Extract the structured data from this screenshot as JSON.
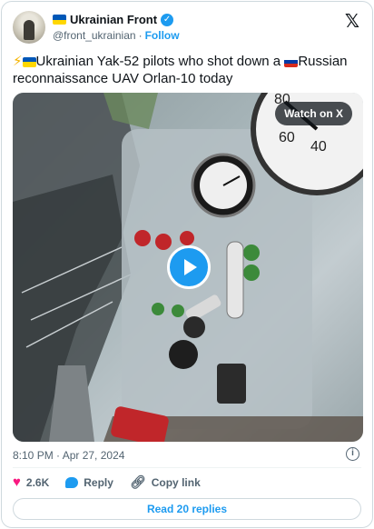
{
  "author": {
    "display_name": "Ukrainian Front",
    "handle": "@front_ukrainian",
    "follow_label": "Follow"
  },
  "tweet": {
    "text_part1": "Ukrainian Yak-52 pilots who shot down a ",
    "text_part2": "Russian reconnaissance UAV Orlan-10 today"
  },
  "media": {
    "watch_label": "Watch on X",
    "gauge_numbers": [
      "80",
      "60",
      "40"
    ]
  },
  "meta": {
    "timestamp": "8:10 PM · Apr 27, 2024"
  },
  "actions": {
    "likes": "2.6K",
    "reply_label": "Reply",
    "copy_link_label": "Copy link"
  },
  "footer": {
    "read_replies_label": "Read 20 replies"
  },
  "colors": {
    "accent": "#1d9bf0",
    "like": "#f91880"
  },
  "icons": [
    "bolt-icon",
    "ukraine-flag-icon",
    "russia-flag-icon",
    "verified-icon",
    "x-logo-icon",
    "play-icon",
    "info-icon",
    "heart-icon",
    "reply-icon",
    "link-icon"
  ]
}
